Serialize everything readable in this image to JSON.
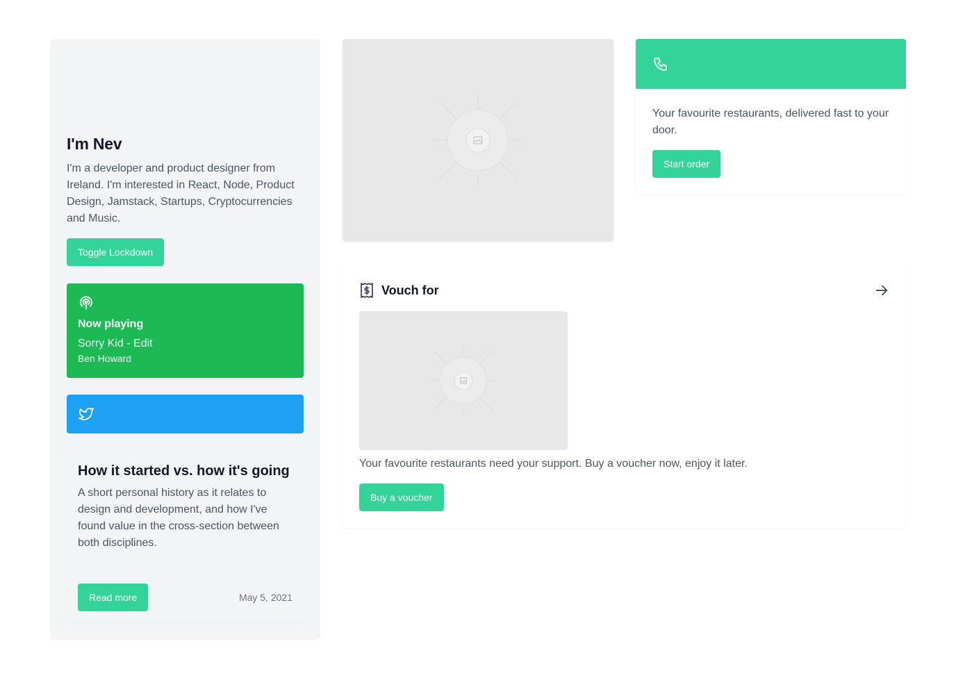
{
  "profile": {
    "heading": "I'm Nev",
    "bio": "I'm a developer and product designer from Ireland. I'm interested in React, Node, Product Design, Jamstack, Startups, Cryptocurrencies and Music.",
    "toggle_label": "Toggle Lockdown"
  },
  "now_playing": {
    "icon": "podcast-icon",
    "label": "Now playing",
    "track": "Sorry Kid - Edit",
    "artist": "Ben Howard",
    "color": "#1db954"
  },
  "twitter": {
    "icon": "twitter-icon",
    "color": "#1da1f2"
  },
  "post": {
    "title": "How it started vs. how it's going",
    "excerpt": "A short personal history as it relates to design and development, and how I've found value in the cross-section between both disciplines.",
    "button_label": "Read more",
    "date": "May 5, 2021"
  },
  "order": {
    "icon": "phone-icon",
    "description": "Your favourite restaurants, delivered fast to your door.",
    "button_label": "Start order"
  },
  "voucher": {
    "icon": "receipt-dollar-icon",
    "title": "Vouch for",
    "arrow_icon": "arrow-right-icon",
    "description": "Your favourite restaurants need your support. Buy a voucher now, enjoy it later.",
    "button_label": "Buy a voucher"
  },
  "theme": {
    "accent": "#34d399",
    "panel_bg": "#f3f4f6",
    "placeholder_bg": "#e8e8e8"
  }
}
